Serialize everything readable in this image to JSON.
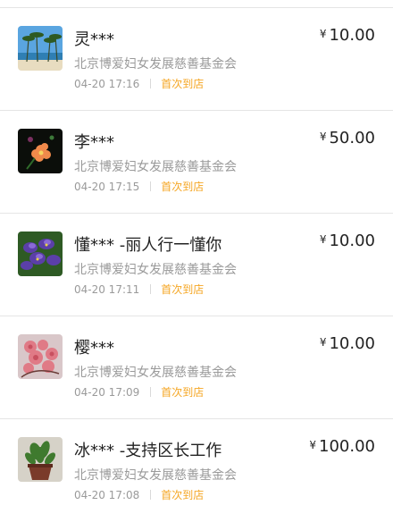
{
  "currency_symbol": "¥",
  "donations": [
    {
      "name": "灵***",
      "organization": "北京博爱妇女发展慈善基金会",
      "time": "04-20 17:16",
      "tag": "首次到店",
      "amount": "10.00",
      "avatar_icon": "beach-palm-photo"
    },
    {
      "name": "李***",
      "organization": "北京博爱妇女发展慈善基金会",
      "time": "04-20 17:15",
      "tag": "首次到店",
      "amount": "50.00",
      "avatar_icon": "orange-flower-photo"
    },
    {
      "name": "懂*** -丽人行一懂你",
      "organization": "北京博爱妇女发展慈善基金会",
      "time": "04-20 17:11",
      "tag": "首次到店",
      "amount": "10.00",
      "avatar_icon": "purple-iris-photo"
    },
    {
      "name": "樱***",
      "organization": "北京博爱妇女发展慈善基金会",
      "time": "04-20 17:09",
      "tag": "首次到店",
      "amount": "10.00",
      "avatar_icon": "pink-blossom-photo"
    },
    {
      "name": "冰*** -支持区长工作",
      "organization": "北京博爱妇女发展慈善基金会",
      "time": "04-20 17:08",
      "tag": "首次到店",
      "amount": "100.00",
      "avatar_icon": "potted-plant-photo"
    }
  ],
  "colors": {
    "tag": "#f5a623",
    "divider": "#e5e5e5",
    "secondary_text": "#9a9a9a"
  }
}
